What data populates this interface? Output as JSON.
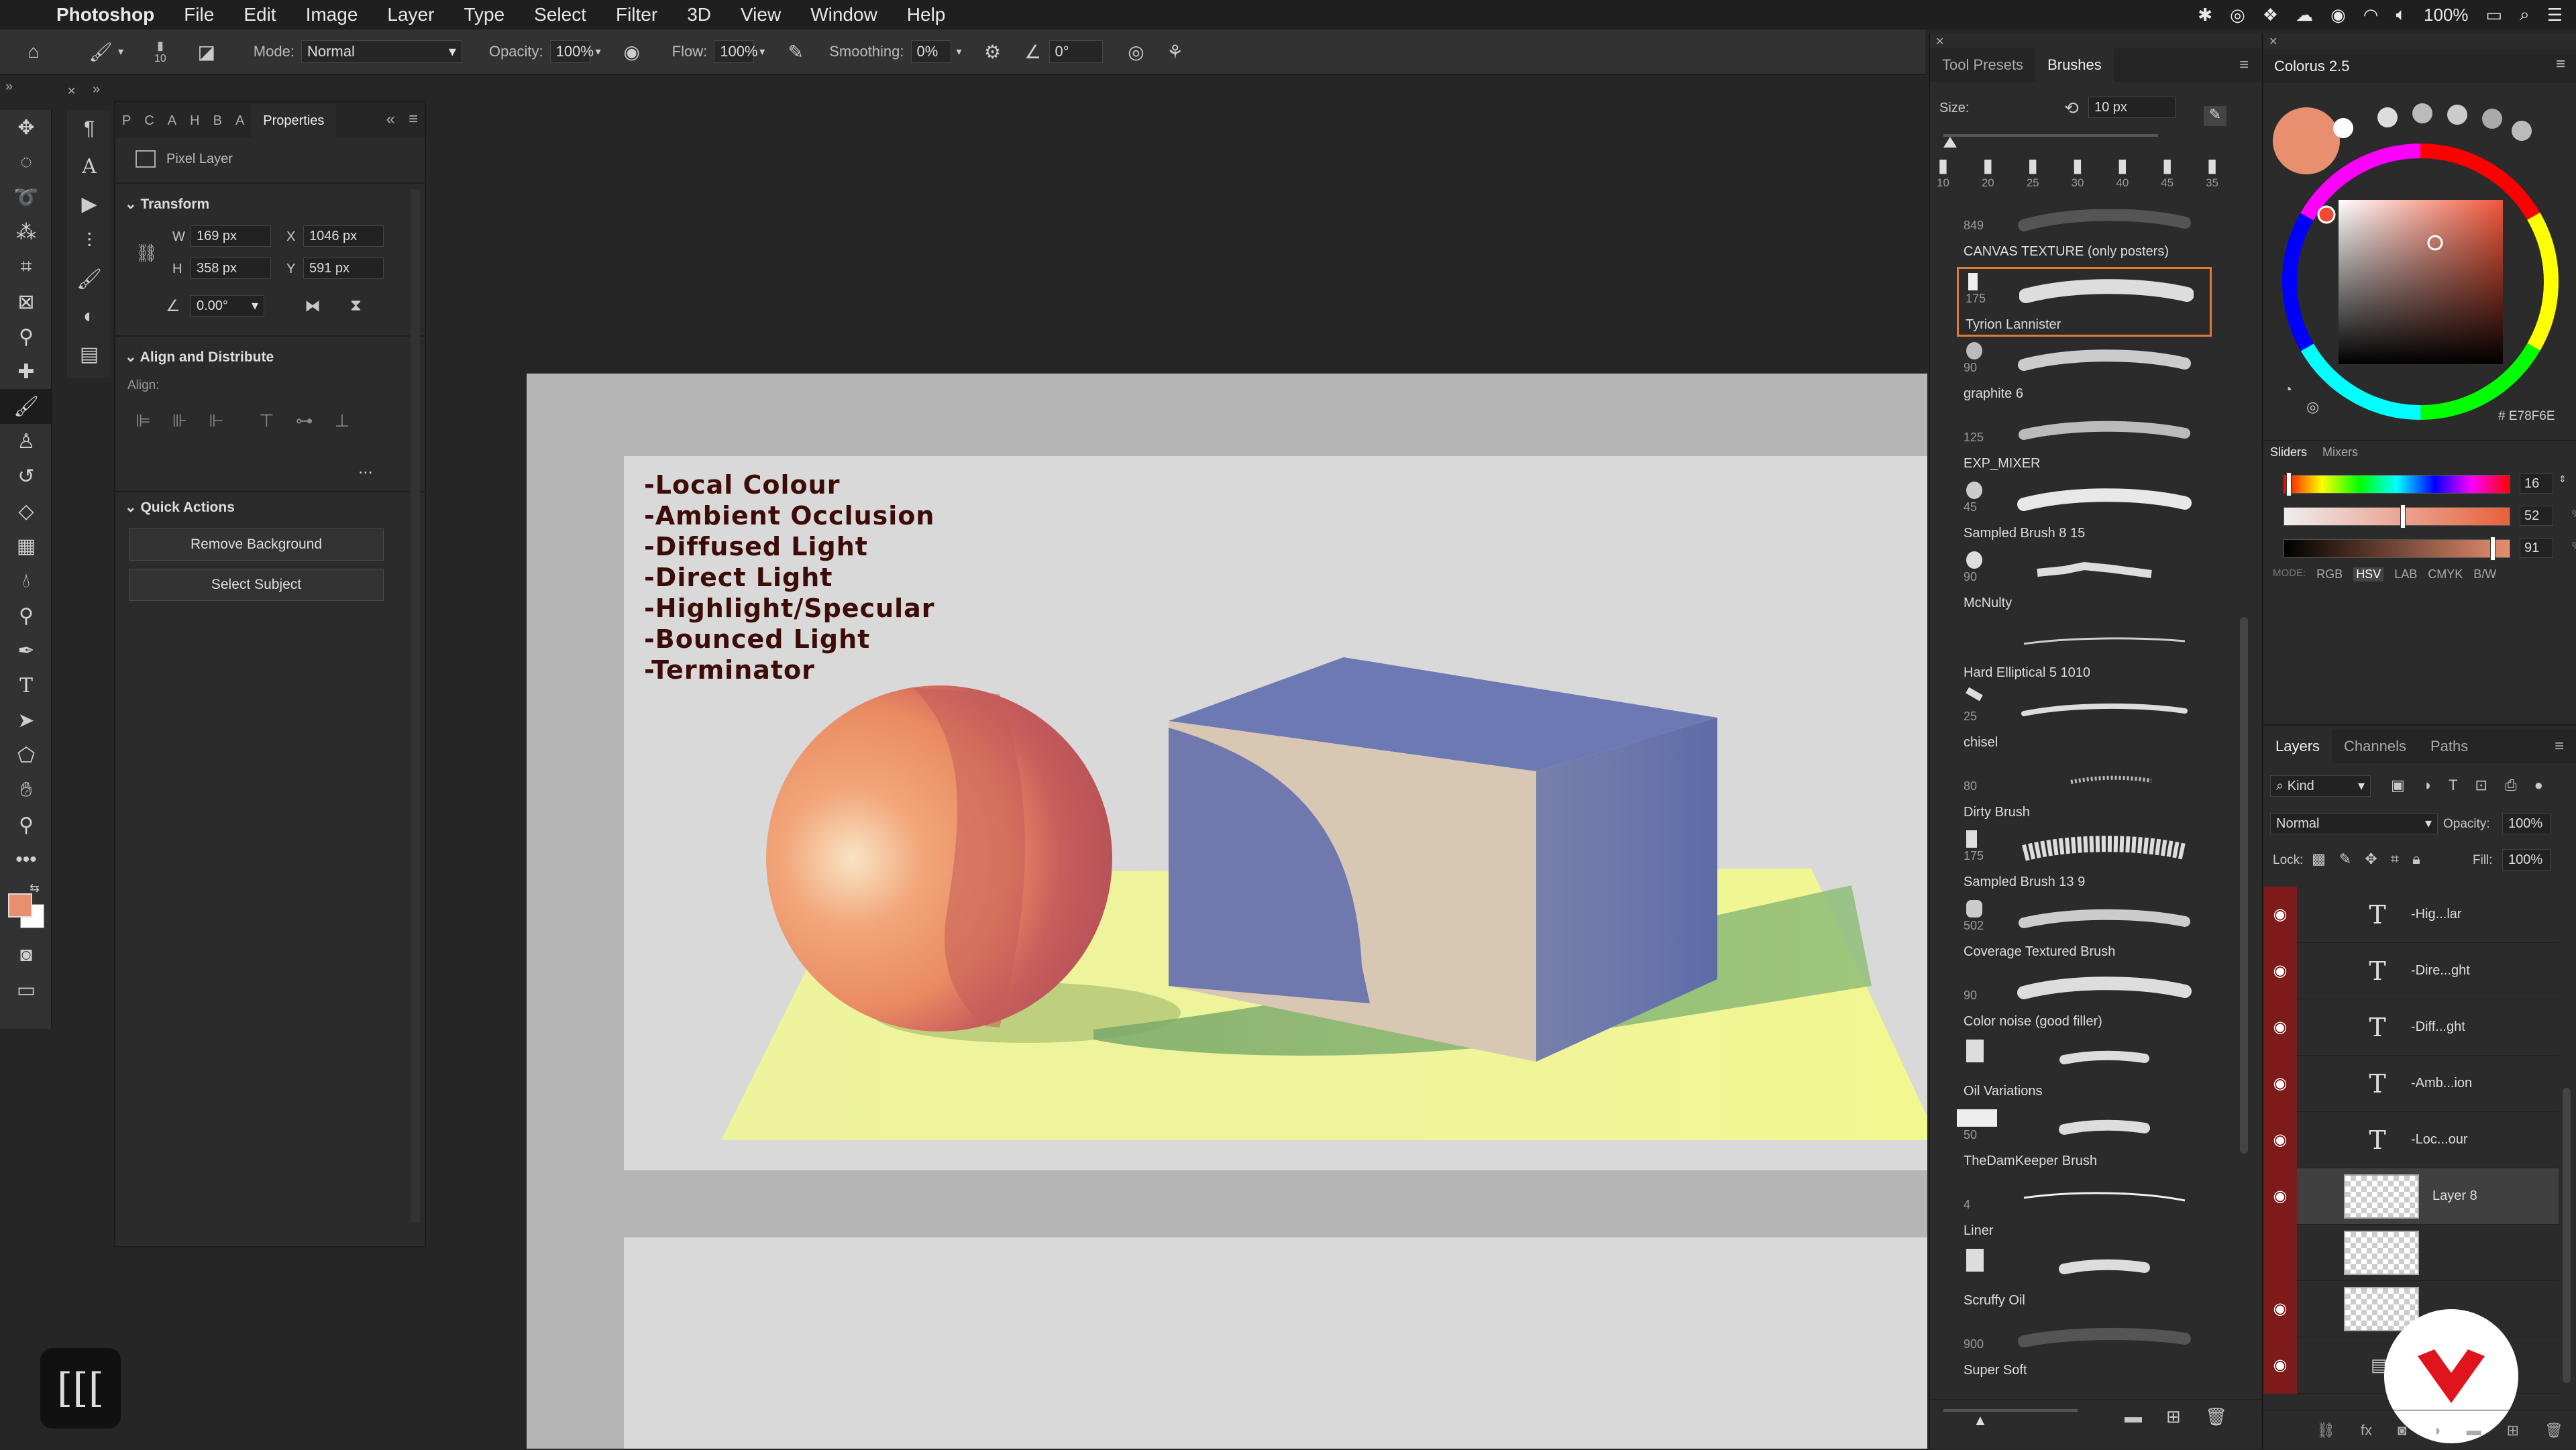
{
  "menubar": {
    "app_name": "Photoshop",
    "items": [
      "File",
      "Edit",
      "Image",
      "Layer",
      "Type",
      "Select",
      "Filter",
      "3D",
      "View",
      "Window",
      "Help"
    ],
    "battery": "100%"
  },
  "options_bar": {
    "brush_size": "10",
    "mode_label": "Mode:",
    "mode_value": "Normal",
    "opacity_label": "Opacity:",
    "opacity_value": "100%",
    "flow_label": "Flow:",
    "flow_value": "100%",
    "smoothing_label": "Smoothing:",
    "smoothing_value": "0%",
    "angle_value": "0°"
  },
  "properties": {
    "tab_letters": [
      "P",
      "C",
      "A",
      "H",
      "B",
      "A"
    ],
    "tab_active": "Properties",
    "layer_type": "Pixel Layer",
    "transform_title": "Transform",
    "w_label": "W",
    "w_value": "169 px",
    "h_label": "H",
    "h_value": "358 px",
    "x_label": "X",
    "x_value": "1046 px",
    "y_label": "Y",
    "y_value": "591 px",
    "angle_value": "0.00°",
    "align_title": "Align and Distribute",
    "align_label": "Align:",
    "more": "...",
    "quick_title": "Quick Actions",
    "remove_bg": "Remove Background",
    "select_subject": "Select Subject"
  },
  "canvas": {
    "lines": [
      "-Local Colour",
      "-Ambient Occlusion",
      "-Diffused Light",
      "-Direct Light",
      "-Highlight/Specular",
      "-Bounced Light",
      "-Terminator"
    ]
  },
  "brushes_panel": {
    "tabs": [
      "Tool Presets",
      "Brushes"
    ],
    "size_label": "Size:",
    "size_value": "10 px",
    "preset_sizes": [
      "10",
      "20",
      "25",
      "30",
      "40",
      "45",
      "35"
    ],
    "items": [
      {
        "num": "849",
        "name": "CANVAS TEXTURE (only posters)"
      },
      {
        "num": "175",
        "name": "Tyrion Lannister"
      },
      {
        "num": "90",
        "name": "graphite 6"
      },
      {
        "num": "125",
        "name": "EXP_MIXER"
      },
      {
        "num": "45",
        "name": "Sampled Brush 8 15"
      },
      {
        "num": "90",
        "name": "McNulty"
      },
      {
        "num": "",
        "name": "Hard Elliptical 5 1010"
      },
      {
        "num": "25",
        "name": "chisel"
      },
      {
        "num": "80",
        "name": "Dirty Brush"
      },
      {
        "num": "175",
        "name": "Sampled Brush 13 9"
      },
      {
        "num": "502",
        "name": "Coverage Textured Brush"
      },
      {
        "num": "90",
        "name": "Color noise (good filler)"
      },
      {
        "num": "",
        "name": "Oil Variations"
      },
      {
        "num": "50",
        "name": "TheDamKeeper Brush"
      },
      {
        "num": "4",
        "name": "Liner"
      },
      {
        "num": "",
        "name": "Scruffy Oil"
      },
      {
        "num": "900",
        "name": "Super Soft"
      }
    ]
  },
  "colourus": {
    "title": "Colorus 2.5",
    "hex": "# E78F6E",
    "tabs": [
      "Sliders",
      "Mixers"
    ],
    "slider_values": [
      "16",
      "52",
      "91"
    ],
    "mode_label": "MODE:",
    "modes": [
      "RGB",
      "HSV",
      "LAB",
      "CMYK",
      "B/W"
    ],
    "active_mode": "HSV",
    "current_color": "#E78F6E"
  },
  "layers_panel": {
    "tabs": [
      "Layers",
      "Channels",
      "Paths"
    ],
    "kind_label": "Kind",
    "blend_mode": "Normal",
    "opacity_label": "Opacity:",
    "opacity_value": "100%",
    "lock_label": "Lock:",
    "fill_label": "Fill:",
    "fill_value": "100%",
    "rows": [
      {
        "type": "text",
        "name": "-Hig...lar"
      },
      {
        "type": "text",
        "name": "-Dire...ght"
      },
      {
        "type": "text",
        "name": "-Diff...ght"
      },
      {
        "type": "text",
        "name": "-Amb...ion"
      },
      {
        "type": "text",
        "name": "-Loc...our"
      },
      {
        "type": "pixel",
        "name": "Layer 8"
      }
    ]
  }
}
